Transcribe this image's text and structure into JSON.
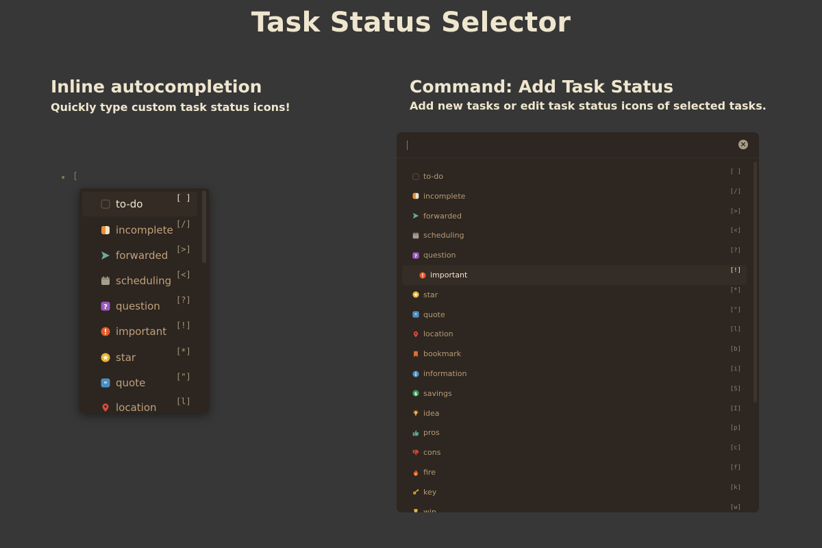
{
  "page_title": "Task Status Selector",
  "left": {
    "title": "Inline autocompletion",
    "subtitle": "Quickly type custom task status icons!",
    "bullet": "•",
    "typed_text": "[",
    "items": [
      {
        "label": "to-do",
        "code": "[ ]",
        "icon": "empty-checkbox-icon"
      },
      {
        "label": "incomplete",
        "code": "[/]",
        "icon": "half-circle-icon"
      },
      {
        "label": "forwarded",
        "code": "[>]",
        "icon": "send-arrow-icon"
      },
      {
        "label": "scheduling",
        "code": "[<]",
        "icon": "calendar-icon"
      },
      {
        "label": "question",
        "code": "[?]",
        "icon": "question-icon"
      },
      {
        "label": "important",
        "code": "[!]",
        "icon": "exclamation-icon"
      },
      {
        "label": "star",
        "code": "[*]",
        "icon": "star-icon"
      },
      {
        "label": "quote",
        "code": "[\"]",
        "icon": "quote-icon"
      },
      {
        "label": "location",
        "code": "[l]",
        "icon": "location-pin-icon"
      }
    ]
  },
  "right": {
    "title": "Command: Add Task Status",
    "subtitle": "Add new tasks or edit task status icons of selected tasks.",
    "clear_glyph": "×",
    "items": [
      {
        "label": "to-do",
        "code": "[ ]",
        "icon": "empty-checkbox-icon"
      },
      {
        "label": "incomplete",
        "code": "[/]",
        "icon": "half-circle-icon"
      },
      {
        "label": "forwarded",
        "code": "[>]",
        "icon": "send-arrow-icon"
      },
      {
        "label": "scheduling",
        "code": "[<]",
        "icon": "calendar-icon"
      },
      {
        "label": "question",
        "code": "[?]",
        "icon": "question-icon"
      },
      {
        "label": "important",
        "code": "[!]",
        "icon": "exclamation-icon"
      },
      {
        "label": "star",
        "code": "[*]",
        "icon": "star-icon"
      },
      {
        "label": "quote",
        "code": "[\"]",
        "icon": "quote-icon"
      },
      {
        "label": "location",
        "code": "[l]",
        "icon": "location-pin-icon"
      },
      {
        "label": "bookmark",
        "code": "[b]",
        "icon": "bookmark-icon"
      },
      {
        "label": "information",
        "code": "[i]",
        "icon": "info-icon"
      },
      {
        "label": "savings",
        "code": "[S]",
        "icon": "savings-icon"
      },
      {
        "label": "idea",
        "code": "[I]",
        "icon": "lightbulb-icon"
      },
      {
        "label": "pros",
        "code": "[p]",
        "icon": "thumbs-up-icon"
      },
      {
        "label": "cons",
        "code": "[c]",
        "icon": "thumbs-down-icon"
      },
      {
        "label": "fire",
        "code": "[f]",
        "icon": "fire-icon"
      },
      {
        "label": "key",
        "code": "[k]",
        "icon": "key-icon"
      },
      {
        "label": "win",
        "code": "[w]",
        "icon": "trophy-icon"
      }
    ]
  },
  "colors": {
    "background": "#373737",
    "panel": "#2d2621",
    "heading": "#efe6cf",
    "item_label": "#b59b75"
  }
}
